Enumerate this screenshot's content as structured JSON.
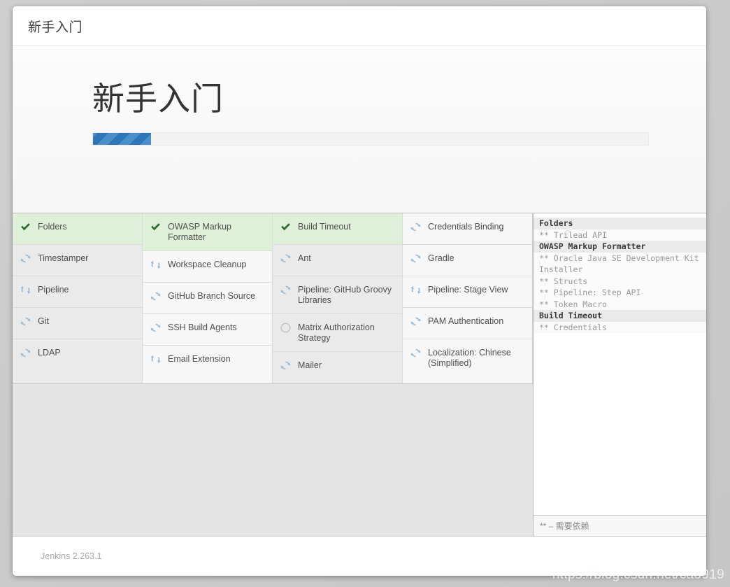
{
  "window": {
    "header_title": "新手入门"
  },
  "hero": {
    "heading": "新手入门",
    "progress_percent": 10.5
  },
  "colors": {
    "progress_fill": "#2d77b8",
    "progress_stripe": "#4a8fc9",
    "done_row_bg": "#dff0d8",
    "check_green": "#2c6b2f",
    "spinner_blue": "#9dbcd4"
  },
  "plugin_grid": {
    "columns": [
      {
        "cells": [
          {
            "label": "Folders",
            "status": "done",
            "icon": "check-icon"
          },
          {
            "label": "Timestamper",
            "status": "installing",
            "icon": "spinner-icon"
          },
          {
            "label": "Pipeline",
            "status": "installing",
            "icon": "spinner-icon"
          },
          {
            "label": "Git",
            "status": "installing",
            "icon": "spinner-icon"
          },
          {
            "label": "LDAP",
            "status": "installing",
            "icon": "spinner-icon"
          }
        ]
      },
      {
        "cells": [
          {
            "label": "OWASP Markup Formatter",
            "status": "done",
            "icon": "check-icon"
          },
          {
            "label": "Workspace Cleanup",
            "status": "installing",
            "icon": "spinner-icon"
          },
          {
            "label": "GitHub Branch Source",
            "status": "installing",
            "icon": "spinner-icon"
          },
          {
            "label": "SSH Build Agents",
            "status": "installing",
            "icon": "spinner-icon"
          },
          {
            "label": "Email Extension",
            "status": "installing",
            "icon": "spinner-icon"
          }
        ]
      },
      {
        "cells": [
          {
            "label": "Build Timeout",
            "status": "done",
            "icon": "check-icon"
          },
          {
            "label": "Ant",
            "status": "installing",
            "icon": "spinner-icon"
          },
          {
            "label": "Pipeline: GitHub Groovy Libraries",
            "status": "installing",
            "icon": "spinner-icon"
          },
          {
            "label": "Matrix Authorization Strategy",
            "status": "pending",
            "icon": "circle-icon"
          },
          {
            "label": "Mailer",
            "status": "installing",
            "icon": "spinner-icon"
          }
        ]
      },
      {
        "cells": [
          {
            "label": "Credentials Binding",
            "status": "installing",
            "icon": "spinner-icon"
          },
          {
            "label": "Gradle",
            "status": "installing",
            "icon": "spinner-icon"
          },
          {
            "label": "Pipeline: Stage View",
            "status": "installing",
            "icon": "spinner-icon"
          },
          {
            "label": "PAM Authentication",
            "status": "installing",
            "icon": "spinner-icon"
          },
          {
            "label": "Localization: Chinese (Simplified)",
            "status": "installing",
            "icon": "spinner-icon"
          }
        ]
      }
    ]
  },
  "log_panel": {
    "lines": [
      {
        "text": "Folders",
        "kind": "main"
      },
      {
        "text": "** Trilead API",
        "kind": "dep"
      },
      {
        "text": "OWASP Markup Formatter",
        "kind": "main"
      },
      {
        "text": "** Oracle Java SE Development Kit Installer",
        "kind": "dep"
      },
      {
        "text": "** Structs",
        "kind": "dep"
      },
      {
        "text": "** Pipeline: Step API",
        "kind": "dep"
      },
      {
        "text": "** Token Macro",
        "kind": "dep"
      },
      {
        "text": "Build Timeout",
        "kind": "main"
      },
      {
        "text": "** Credentials",
        "kind": "dep"
      }
    ],
    "footer_legend": "** – 需要依赖"
  },
  "footer": {
    "version": "Jenkins 2.263.1"
  },
  "watermark": {
    "text": "https://blog.csdn.net/cao919"
  }
}
